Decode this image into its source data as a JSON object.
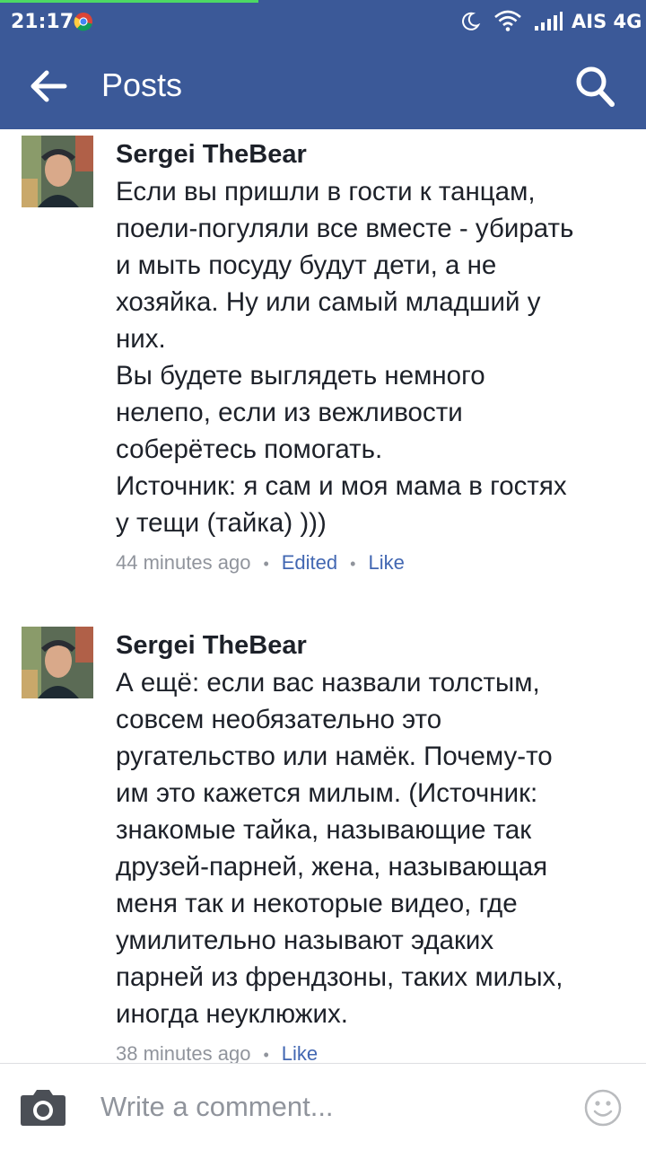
{
  "status_bar": {
    "time": "21:17",
    "carrier": "AIS 4G",
    "icons": [
      "chrome-icon",
      "moon-icon",
      "wifi-icon",
      "signal-icon"
    ]
  },
  "app_bar": {
    "title": "Posts",
    "back_icon": "back-arrow-icon",
    "search_icon": "search-icon"
  },
  "comments": [
    {
      "author": "Sergei TheBear",
      "lines": [
        "Если вы пришли в гости к танцам,",
        "поели-погуляли все вместе - убирать",
        "и мыть посуду будут дети, а не",
        "хозяйка. Ну или самый младший у",
        "них.",
        "Вы будете выглядеть немного",
        "нелепо, если из вежливости",
        "соберётесь помогать.",
        "Источник: я сам и моя мама в гостях",
        "у тещи (тайка) )))"
      ],
      "time": "44 minutes ago",
      "edited": "Edited",
      "like": "Like"
    },
    {
      "author": "Sergei TheBear",
      "lines": [
        "А ещё: если вас назвали толстым,",
        "совсем необязательно это",
        "ругательство или намёк. Почему-то",
        "им это кажется милым. (Источник:",
        "знакомые тайка, называющие так",
        "друзей-парней, жена, называющая",
        "меня так и некоторые видео, где",
        "умилительно называют эдаких",
        "парней из френдзоны, таких милых,",
        "иногда неуклюжих."
      ],
      "time": "38 minutes ago",
      "like": "Like"
    }
  ],
  "composer": {
    "placeholder": "Write a comment...",
    "camera_icon": "camera-icon",
    "emoji_icon": "emoji-icon"
  },
  "colors": {
    "brand": "#3b5998",
    "link": "#4267b2",
    "meta": "#90949c",
    "text": "#1d2129"
  }
}
